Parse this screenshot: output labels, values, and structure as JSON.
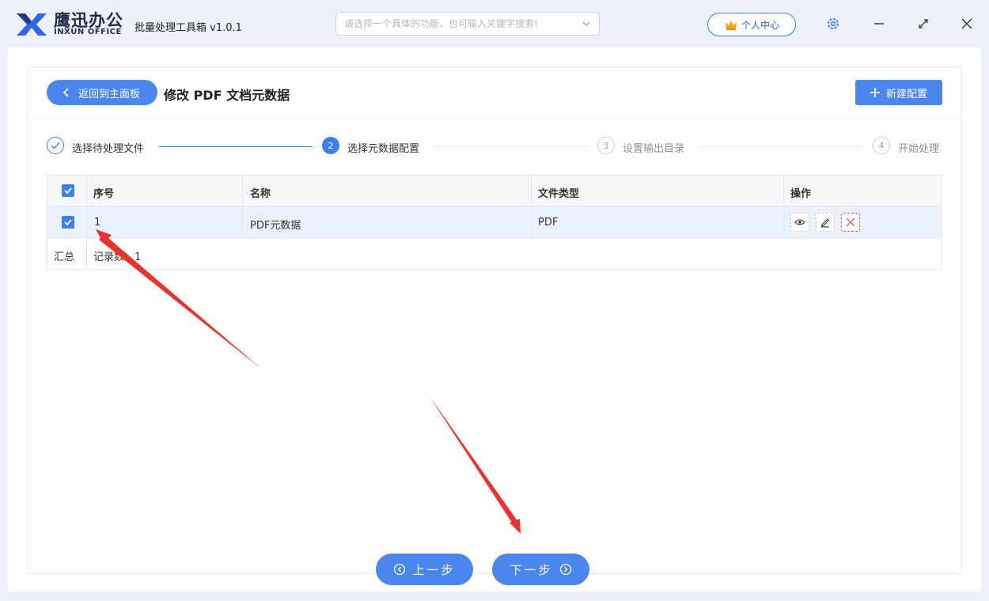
{
  "app": {
    "brand_cn": "鹰迅办公",
    "brand_en": "INXUN OFFICE",
    "name": "批量处理工具箱 v1.0.1"
  },
  "search": {
    "placeholder": "请选择一个具体的功能，也可输入关键字搜索!"
  },
  "personal_center": "个人中心",
  "page": {
    "back_label": "返回到主面板",
    "title": "修改 PDF 文档元数据",
    "new_config_label": "新建配置"
  },
  "steps": [
    {
      "num": "1",
      "label": "选择待处理文件",
      "state": "done"
    },
    {
      "num": "2",
      "label": "选择元数据配置",
      "state": "active"
    },
    {
      "num": "3",
      "label": "设置输出目录",
      "state": "todo"
    },
    {
      "num": "4",
      "label": "开始处理",
      "state": "todo"
    }
  ],
  "table": {
    "headers": [
      "序号",
      "名称",
      "文件类型",
      "操作"
    ],
    "rows": [
      {
        "index": "1",
        "name": "PDF元数据",
        "type": "PDF",
        "checked": true
      }
    ],
    "summary_label": "汇总",
    "record_count": "记录数：1"
  },
  "nav": {
    "prev": "上一步",
    "next": "下一步"
  },
  "colors": {
    "accent": "#4a86ee",
    "checkbox": "#3c7ff0",
    "delete": "#ef5a5a",
    "annotation_arrow": "#e8322b"
  },
  "icons": [
    "logo-icon",
    "chevron-down-icon",
    "crown-icon",
    "gear-icon",
    "minimize-icon",
    "maximize-icon",
    "close-icon",
    "chevron-left-icon",
    "plus-icon",
    "check-icon",
    "eye-icon",
    "edit-icon",
    "delete-icon",
    "arrow-circle-left-icon",
    "arrow-circle-right-icon"
  ]
}
